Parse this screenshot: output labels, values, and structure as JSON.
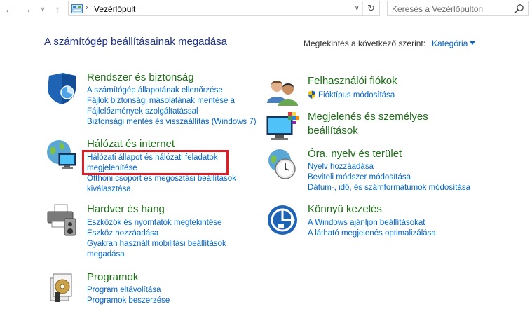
{
  "address_bar": {
    "crumb": "Vezérlőpult"
  },
  "search": {
    "placeholder": "Keresés a Vezérlőpulton"
  },
  "header": {
    "title": "A számítógép beállításainak megadása",
    "view_by_label": "Megtekintés a következő szerint:",
    "view_by_value": "Kategória"
  },
  "categories": [
    {
      "title": "Rendszer és biztonság",
      "links": [
        "A számítógép állapotának ellenőrzése",
        "Fájlok biztonsági másolatának mentése a",
        "Fájlelőzmények szolgáltatással",
        "Biztonsági mentés és visszaállítás (Windows 7)"
      ]
    },
    {
      "title": "Hálózat és internet",
      "links": [
        "Hálózati állapot és hálózati feladatok",
        "megjelenítése",
        "Otthoni csoport és megosztási beállítások",
        "kiválasztása"
      ]
    },
    {
      "title": "Hardver és hang",
      "links": [
        "Eszközök és nyomtatók megtekintése",
        "Eszköz hozzáadása",
        "Gyakran használt mobilitási beállítások",
        "megadása"
      ]
    },
    {
      "title": "Programok",
      "links": [
        "Program eltávolítása",
        "Programok beszerzése"
      ]
    },
    {
      "title": "Felhasználói fiókok",
      "links": [
        "Fióktípus módosítása"
      ]
    },
    {
      "title_line1": "Megjelenés és személyes",
      "title_line2": "beállítások",
      "links": []
    },
    {
      "title": "Óra, nyelv és terület",
      "links": [
        "Nyelv hozzáadása",
        "Beviteli módszer módosítása",
        "Dátum-, idő, és számformátumok módosítása"
      ]
    },
    {
      "title": "Könnyű kezelés",
      "links": [
        "A Windows ajánljon beállításokat",
        "A látható megjelenés optimalizálása"
      ]
    }
  ],
  "colors": {
    "title_green": "#1c6e16",
    "link_blue": "#0066cc",
    "header_blue": "#1e3287",
    "highlight_red": "#e31b23"
  }
}
